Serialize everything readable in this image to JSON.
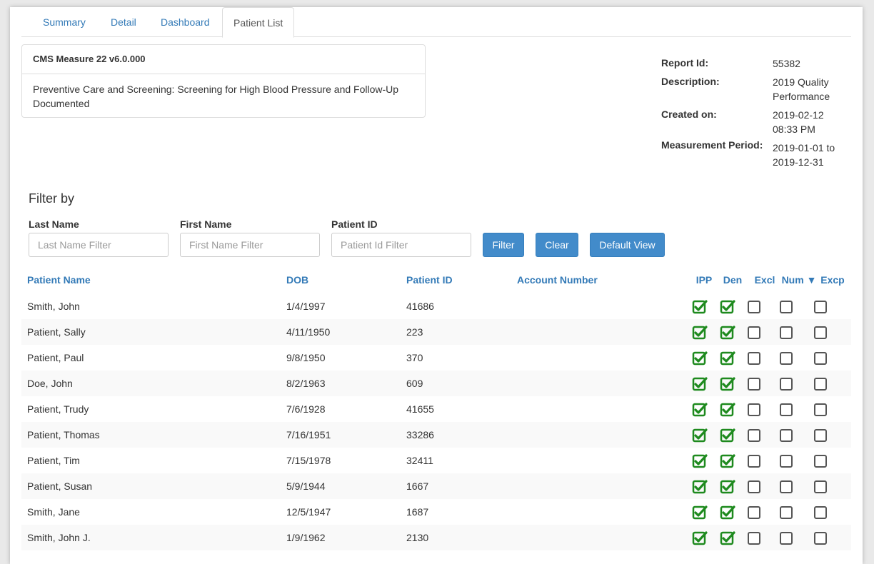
{
  "tabs": [
    {
      "label": "Summary"
    },
    {
      "label": "Detail"
    },
    {
      "label": "Dashboard"
    },
    {
      "label": "Patient List"
    }
  ],
  "measure": {
    "title": "CMS Measure 22 v6.0.000",
    "description": "Preventive Care and Screening: Screening for High Blood Pressure and Follow-Up Documented"
  },
  "report": {
    "id_label": "Report Id:",
    "id_value": "55382",
    "description_label": "Description:",
    "description_value": "2019 Quality Performance",
    "created_label": "Created on:",
    "created_value": "2019-02-12 08:33 PM",
    "period_label": "Measurement Period:",
    "period_value": "2019-01-01 to 2019-12-31"
  },
  "filter": {
    "title": "Filter by",
    "last_name_label": "Last Name",
    "last_name_placeholder": "Last Name Filter",
    "first_name_label": "First Name",
    "first_name_placeholder": "First Name Filter",
    "patient_id_label": "Patient ID",
    "patient_id_placeholder": "Patient Id Filter",
    "filter_button": "Filter",
    "clear_button": "Clear",
    "default_view_button": "Default View"
  },
  "table": {
    "headers": {
      "name": "Patient Name",
      "dob": "DOB",
      "patient_id": "Patient ID",
      "account": "Account Number",
      "ipp": "IPP",
      "den": "Den",
      "excl": "Excl",
      "num": "Num ▼",
      "excp": "Excp"
    },
    "rows": [
      {
        "name": "Smith, John",
        "dob": "1/4/1997",
        "patient_id": "41686",
        "account": "",
        "ipp": true,
        "den": true,
        "excl": false,
        "num": false,
        "excp": false
      },
      {
        "name": "Patient, Sally",
        "dob": "4/11/1950",
        "patient_id": "223",
        "account": "",
        "ipp": true,
        "den": true,
        "excl": false,
        "num": false,
        "excp": false
      },
      {
        "name": "Patient, Paul",
        "dob": "9/8/1950",
        "patient_id": "370",
        "account": "",
        "ipp": true,
        "den": true,
        "excl": false,
        "num": false,
        "excp": false
      },
      {
        "name": "Doe, John",
        "dob": "8/2/1963",
        "patient_id": "609",
        "account": "",
        "ipp": true,
        "den": true,
        "excl": false,
        "num": false,
        "excp": false
      },
      {
        "name": "Patient, Trudy",
        "dob": "7/6/1928",
        "patient_id": "41655",
        "account": "",
        "ipp": true,
        "den": true,
        "excl": false,
        "num": false,
        "excp": false
      },
      {
        "name": "Patient, Thomas",
        "dob": "7/16/1951",
        "patient_id": "33286",
        "account": "",
        "ipp": true,
        "den": true,
        "excl": false,
        "num": false,
        "excp": false
      },
      {
        "name": "Patient, Tim",
        "dob": "7/15/1978",
        "patient_id": "32411",
        "account": "",
        "ipp": true,
        "den": true,
        "excl": false,
        "num": false,
        "excp": false
      },
      {
        "name": "Patient, Susan",
        "dob": "5/9/1944",
        "patient_id": "1667",
        "account": "",
        "ipp": true,
        "den": true,
        "excl": false,
        "num": false,
        "excp": false
      },
      {
        "name": "Smith, Jane",
        "dob": "12/5/1947",
        "patient_id": "1687",
        "account": "",
        "ipp": true,
        "den": true,
        "excl": false,
        "num": false,
        "excp": false
      },
      {
        "name": "Smith, John J.",
        "dob": "1/9/1962",
        "patient_id": "2130",
        "account": "",
        "ipp": true,
        "den": true,
        "excl": false,
        "num": false,
        "excp": false
      }
    ]
  },
  "colors": {
    "link": "#337ab7",
    "button": "#428bca",
    "check": "#1e8a1e"
  }
}
